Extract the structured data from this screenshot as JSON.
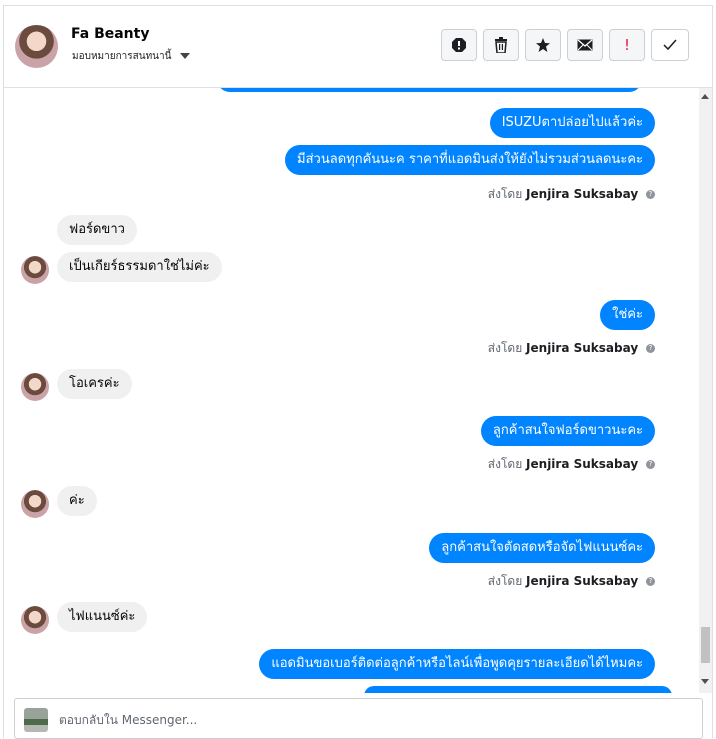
{
  "header": {
    "name": "Fa Beanty",
    "assign_label": "มอบหมายการสนทนานี้"
  },
  "actions": [
    {
      "name": "report-spam-icon"
    },
    {
      "name": "trash-icon"
    },
    {
      "name": "star-icon"
    },
    {
      "name": "mail-icon"
    },
    {
      "name": "priority-icon",
      "label": "!"
    },
    {
      "name": "check-icon"
    }
  ],
  "messages": {
    "m1": "ISUZUตาปล่อยไปแล้วค่ะ",
    "m2": "มีส่วนลดทุกคันนะค ราคาที่แอดมินส่งให้ยังไม่รวมส่วนลดนะคะ",
    "m3": "ฟอร์ดขาว",
    "m4": "เป็นเกียร์ธรรมดาใช่ไม่ค่ะ",
    "m5": "ใช่ค่ะ",
    "m6": "โอเครค่ะ",
    "m7": "ลูกค้าสนใจฟอร์ดขาวนะคะ",
    "m8": "ค่ะ",
    "m9": "ลูกค้าสนใจตัดสดหรือจัดไฟแนนซ์คะ",
    "m10": "ไฟแนนซ์ค่ะ",
    "m11": "แอดมินขอเบอร์ติดต่อลูกค้าหรือไลน์เพื่อพูดคุยรายละเอียดได้ไหมคะ"
  },
  "sent_by": {
    "prefix": "ส่งโดย",
    "agent": "Jenjira Suksabay",
    "help": "?"
  },
  "reply": {
    "placeholder": "ตอบกลับใน Messenger..."
  },
  "colors": {
    "outgoing": "#0084ff",
    "incoming": "#f1f0f0"
  }
}
